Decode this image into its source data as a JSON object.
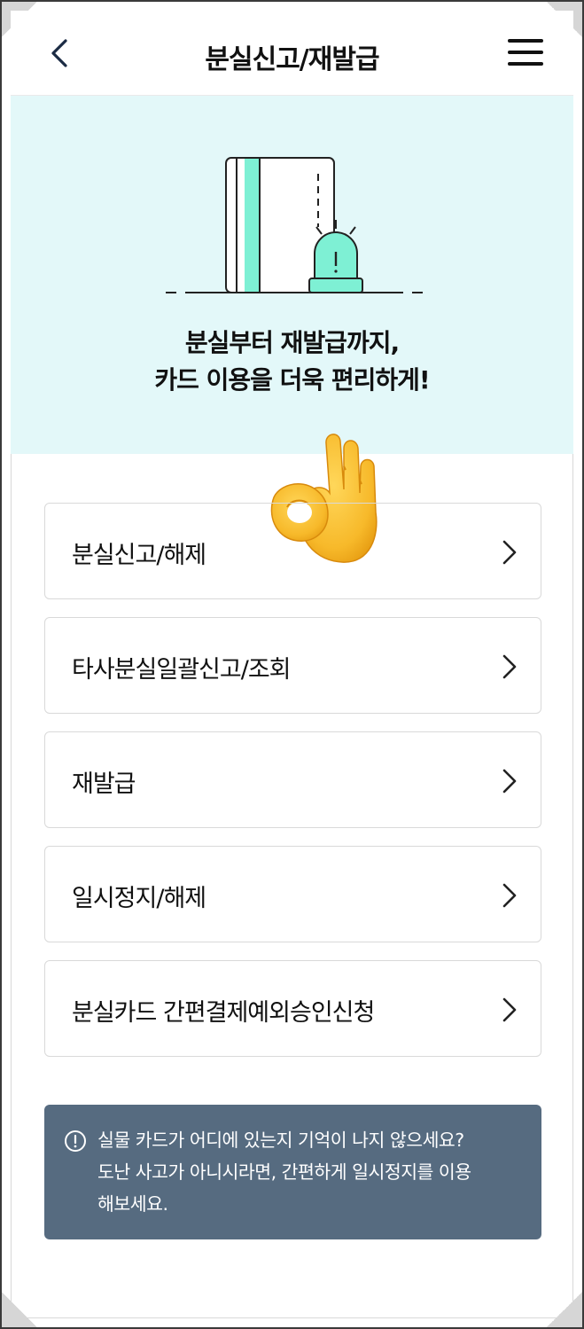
{
  "header": {
    "title": "분실신고/재발급",
    "back_icon": "chevron-left-icon",
    "menu_icon": "hamburger-menu-icon"
  },
  "hero": {
    "line1": "분실부터 재발급까지,",
    "line2": "카드 이용을 더욱 편리하게!",
    "illustration": "card-with-alarm-siren",
    "accent_color": "#7ef0d4",
    "background_color": "#e3f8f9"
  },
  "overlay_emoji": {
    "name": "ok-hand-emoji",
    "glyph": "👌"
  },
  "menu": {
    "items": [
      {
        "label": "분실신고/해제"
      },
      {
        "label": "타사분실일괄신고/조회"
      },
      {
        "label": "재발급"
      },
      {
        "label": "일시정지/해제"
      },
      {
        "label": "분실카드 간편결제예외승인신청"
      }
    ]
  },
  "notice": {
    "icon": "info-circle-icon",
    "line1": "실물 카드가 어디에 있는지 기억이 나지 않으세요?",
    "line2": "도난 사고가 아니시라면, 간편하게 일시정지를 이용",
    "line3": "해보세요.",
    "background_color": "#566b80"
  }
}
